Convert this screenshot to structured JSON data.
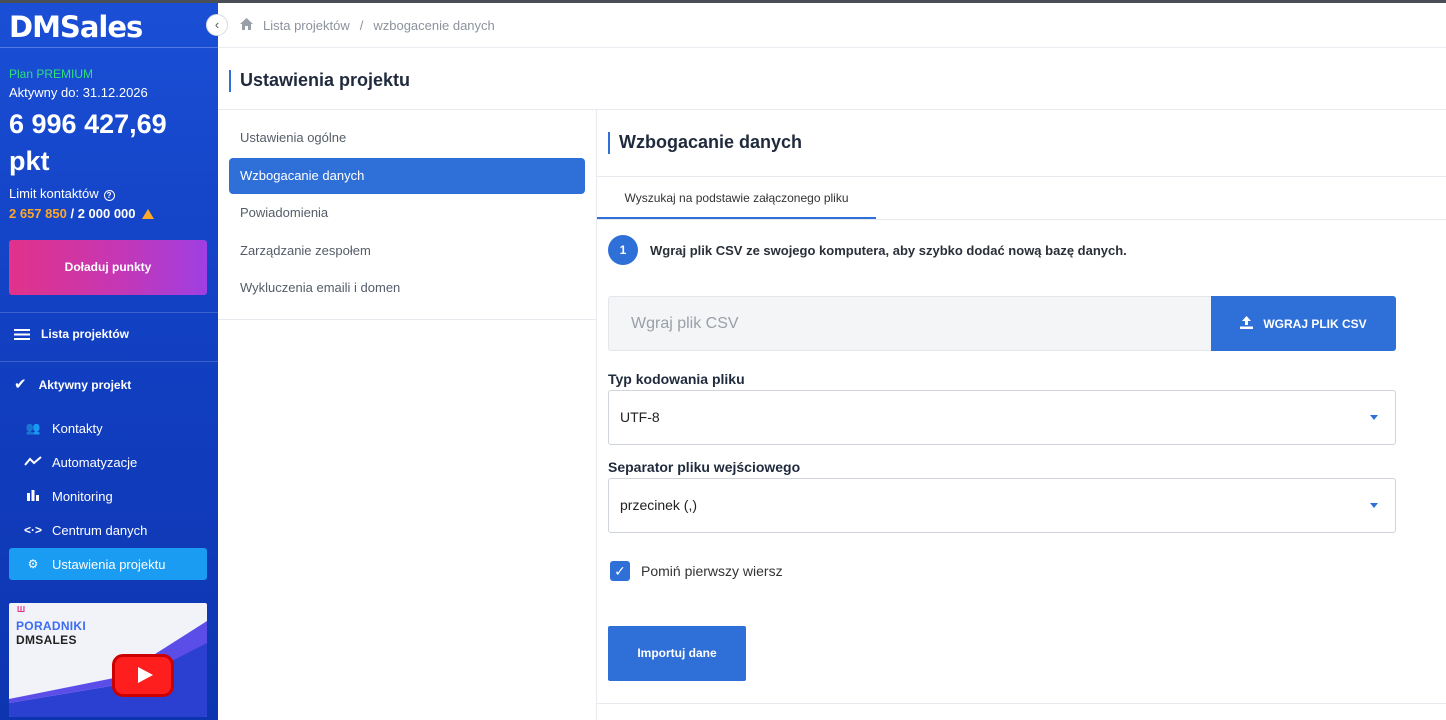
{
  "colors": {
    "accent": "#2f6fd8",
    "sidebar": "#1a4fd6",
    "plan": "#2fe07c",
    "warning": "#ffa726",
    "cta_gradient_start": "#e2328a",
    "cta_gradient_end": "#9f3fe3"
  },
  "sidebar": {
    "logo": "DMSales",
    "plan": "Plan PREMIUM",
    "active_until": "Aktywny do: 31.12.2026",
    "points_value": "6 996 427,69",
    "points_unit": "pkt",
    "limit_label": "Limit kontaktów",
    "limit_used": "2 657 850",
    "limit_separator": " / ",
    "limit_max": "2 000 000",
    "topup_button": "Doładuj punkty",
    "nav_projects": "Lista projektów",
    "nav_active_project": "Aktywny projekt",
    "sub_items": [
      {
        "label": "Kontakty",
        "icon": "users-icon"
      },
      {
        "label": "Automatyzacje",
        "icon": "trend-icon"
      },
      {
        "label": "Monitoring",
        "icon": "bar-chart-icon"
      },
      {
        "label": "Centrum danych",
        "icon": "code-icon"
      },
      {
        "label": "Ustawienia projektu",
        "icon": "gear-icon"
      }
    ],
    "promo_line1": "PORADNIKI",
    "promo_line2": "DMSALES"
  },
  "breadcrumb": {
    "home_icon": "home-icon",
    "items": [
      "Lista projektów",
      "wzbogacenie danych"
    ]
  },
  "page": {
    "title": "Ustawienia projektu"
  },
  "settings_menu": {
    "items": [
      "Ustawienia ogólne",
      "Wzbogacanie danych",
      "Powiadomienia",
      "Zarządzanie zespołem",
      "Wykluczenia emaili i domen"
    ],
    "selected": 1
  },
  "content": {
    "title": "Wzbogacanie danych",
    "tab": "Wyszukaj na podstawie załączonego pliku",
    "step_number": "1",
    "step_text": "Wgraj plik CSV ze swojego komputera, aby szybko dodać nową bazę danych.",
    "file_placeholder": "Wgraj plik CSV",
    "upload_button": "WGRAJ PLIK CSV",
    "encoding_label": "Typ kodowania pliku",
    "encoding_value": "UTF-8",
    "separator_label": "Separator pliku wejściowego",
    "separator_value": "przecinek (,)",
    "skip_first_row_label": "Pomiń pierwszy wiersz",
    "skip_first_row_checked": true,
    "import_button": "Importuj dane"
  }
}
